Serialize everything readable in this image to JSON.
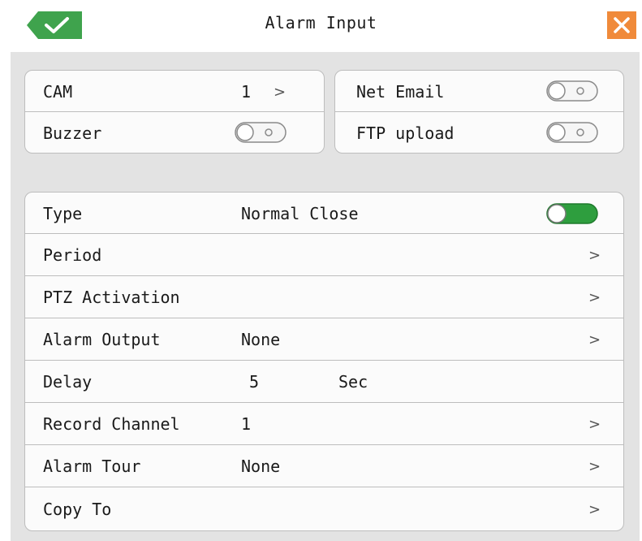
{
  "header": {
    "title": "Alarm Input",
    "ok_icon": "checkmark-icon",
    "close_icon": "close-x-icon",
    "ok_color": "#3fa34d",
    "close_color": "#f08a3a"
  },
  "top_left_card": {
    "cam": {
      "label": "CAM",
      "value": "1"
    },
    "buzzer": {
      "label": "Buzzer",
      "state": "off"
    }
  },
  "top_right_card": {
    "net_email": {
      "label": "Net Email",
      "state": "off"
    },
    "ftp_upload": {
      "label": "FTP upload",
      "state": "off"
    }
  },
  "settings": {
    "type": {
      "label": "Type",
      "value": "Normal Close",
      "state": "on"
    },
    "period": {
      "label": "Period"
    },
    "ptz": {
      "label": "PTZ Activation"
    },
    "alarm_output": {
      "label": "Alarm Output",
      "value": "None"
    },
    "delay": {
      "label": "Delay",
      "value": "5",
      "unit": "Sec"
    },
    "record_channel": {
      "label": "Record Channel",
      "value": "1"
    },
    "alarm_tour": {
      "label": "Alarm Tour",
      "value": "None"
    },
    "copy_to": {
      "label": "Copy To"
    }
  },
  "arrow_glyph": ">",
  "toggle_on_color": "#2e9e3e"
}
